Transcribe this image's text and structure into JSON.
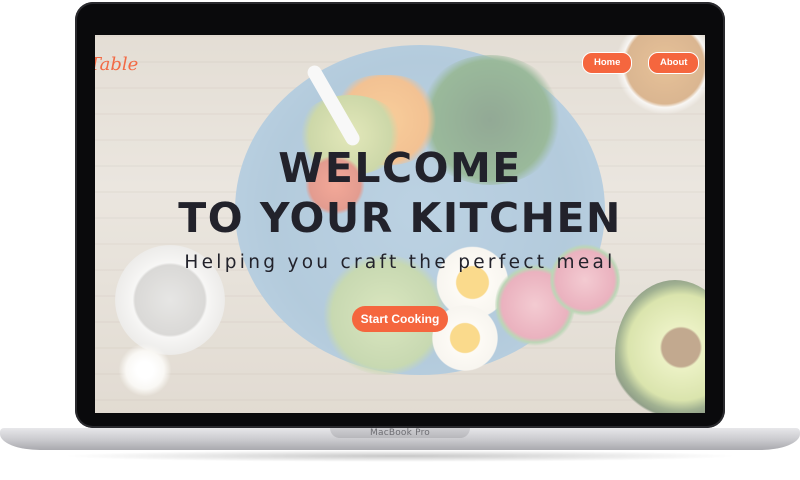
{
  "device": {
    "label": "MacBook Pro"
  },
  "site": {
    "logo_text": "Table",
    "nav": [
      {
        "label": "Home"
      },
      {
        "label": "About"
      }
    ]
  },
  "hero": {
    "title_line1": "WELCOME",
    "title_line2": "TO YOUR KITCHEN",
    "subtitle": "Helping you craft the perfect meal",
    "cta_label": "Start Cooking"
  },
  "colors": {
    "accent": "#f5663e",
    "heading": "#22222b"
  }
}
